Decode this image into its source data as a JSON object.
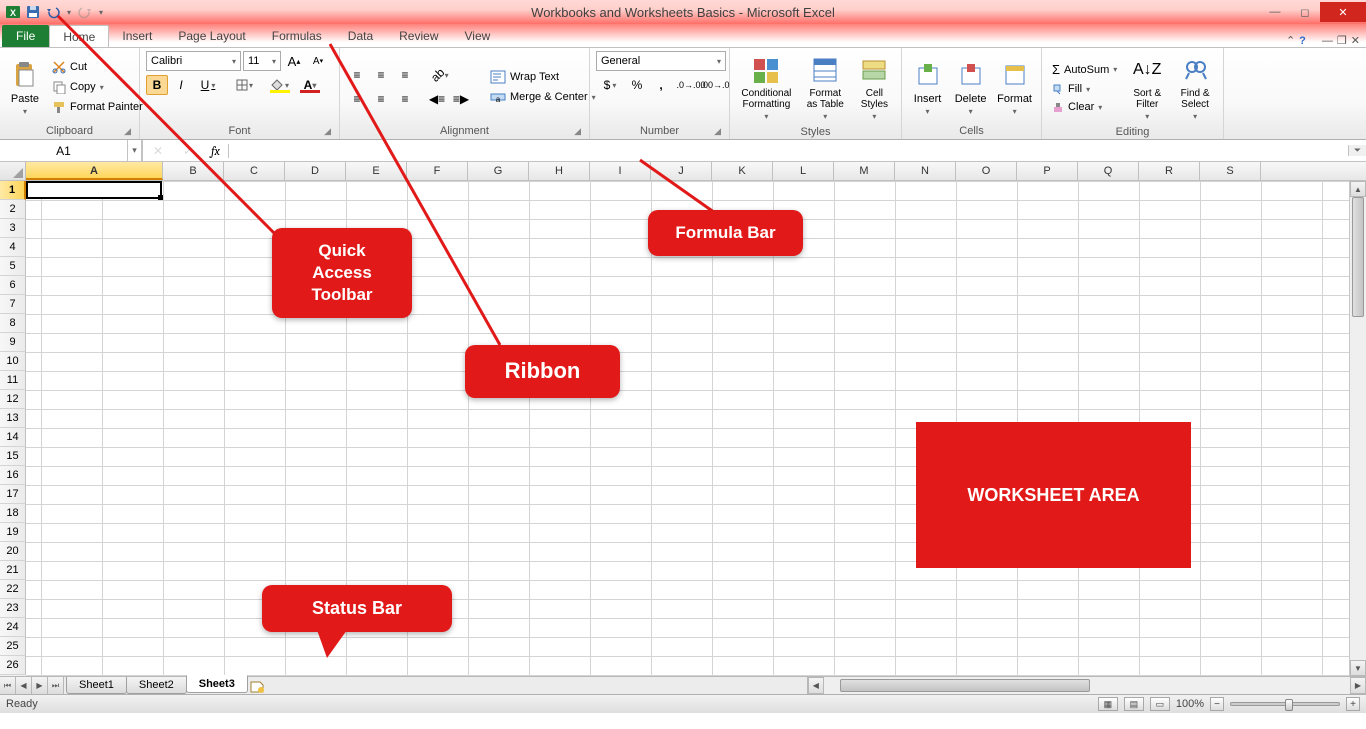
{
  "title": "Workbooks and Worksheets Basics - Microsoft Excel",
  "qat": {
    "icons": [
      "excel-icon",
      "save-icon",
      "undo-icon",
      "redo-icon",
      "customize-icon"
    ]
  },
  "tabs": {
    "file": "File",
    "list": [
      "Home",
      "Insert",
      "Page Layout",
      "Formulas",
      "Data",
      "Review",
      "View"
    ],
    "active": "Home"
  },
  "ribbon": {
    "clipboard": {
      "label": "Clipboard",
      "paste": "Paste",
      "cut": "Cut",
      "copy": "Copy",
      "painter": "Format Painter"
    },
    "font": {
      "label": "Font",
      "name": "Calibri",
      "size": "11",
      "growA": "A",
      "shrinkA": "A",
      "bold": "B",
      "italic": "I",
      "underline": "U"
    },
    "alignment": {
      "label": "Alignment",
      "wrap": "Wrap Text",
      "merge": "Merge & Center"
    },
    "number": {
      "label": "Number",
      "format": "General",
      "currency": "$",
      "percent": "%",
      "comma": ",",
      "incdec": ".0",
      "decdec": ".00"
    },
    "styles": {
      "label": "Styles",
      "cond": "Conditional Formatting",
      "table": "Format as Table",
      "cell": "Cell Styles"
    },
    "cells": {
      "label": "Cells",
      "insert": "Insert",
      "delete": "Delete",
      "format": "Format"
    },
    "editing": {
      "label": "Editing",
      "autosum": "AutoSum",
      "fill": "Fill",
      "clear": "Clear",
      "sort": "Sort & Filter",
      "find": "Find & Select"
    }
  },
  "namebox": "A1",
  "fx_label": "fx",
  "columns": [
    "A",
    "B",
    "C",
    "D",
    "E",
    "F",
    "G",
    "H",
    "I",
    "J",
    "K",
    "L",
    "M",
    "N",
    "O",
    "P",
    "Q",
    "R",
    "S"
  ],
  "rows": [
    "1",
    "2",
    "3",
    "4",
    "5",
    "6",
    "7",
    "8",
    "9",
    "10",
    "11",
    "12",
    "13",
    "14",
    "15",
    "16",
    "17",
    "18",
    "19",
    "20",
    "21",
    "22",
    "23",
    "24",
    "25",
    "26"
  ],
  "sheets": {
    "list": [
      "Sheet1",
      "Sheet2",
      "Sheet3"
    ],
    "active": "Sheet3"
  },
  "status": {
    "ready": "Ready",
    "zoom": "100%"
  },
  "callouts": {
    "qat": "Quick Access Toolbar",
    "ribbon": "Ribbon",
    "fbar": "Formula Bar",
    "sbar": "Status Bar",
    "wsarea": "WORKSHEET AREA"
  }
}
